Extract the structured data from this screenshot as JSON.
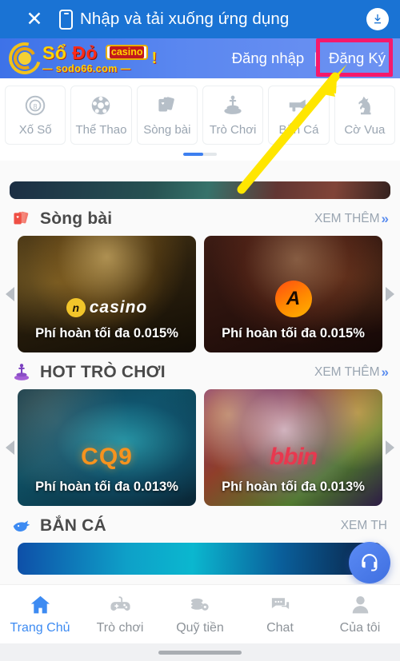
{
  "topbar": {
    "close_icon": "close-x-icon",
    "phone_icon": "mobile-phone-icon",
    "title": "Nhập và tải xuống ứng dụng",
    "download_icon": "download-arrow-icon"
  },
  "site_header": {
    "logo": {
      "main_left": "Sổ ",
      "main_right": "Đỏ",
      "badge": "casino",
      "sub": "— sodo66.com —",
      "exclaim": "!"
    },
    "login_label": "Đăng nhập",
    "divider": "|",
    "register_label": "Đăng Ký",
    "highlight_color": "#f5196b"
  },
  "categories": [
    {
      "label": "Xố Số",
      "icon": "lottery-ball-icon"
    },
    {
      "label": "Thể Thao",
      "icon": "soccer-ball-icon"
    },
    {
      "label": "Sòng bài",
      "icon": "playing-cards-icon"
    },
    {
      "label": "Trò Chơi",
      "icon": "joystick-icon"
    },
    {
      "label": "Bắn Cá",
      "icon": "fish-gun-icon"
    },
    {
      "label": "Cờ Vua",
      "icon": "chess-knight-icon"
    }
  ],
  "pager": {
    "active_index": 0,
    "count": 2
  },
  "sections": [
    {
      "id": "song-bai",
      "title": "Sòng bài",
      "icon": "playing-cards-icon",
      "more_label": "XEM THÊM",
      "more_chevron": "»",
      "cards": [
        {
          "brand": "casino",
          "brand_mark": "n",
          "fee": "Phí hoàn tối đa 0.015%",
          "art": "art-a"
        },
        {
          "brand": "AE",
          "brand_mark": "A",
          "fee": "Phí hoàn tối đa 0.015%",
          "art": "art-b"
        }
      ]
    },
    {
      "id": "hot-tro-choi",
      "title": "HOT TRÒ CHƠI",
      "icon": "joystick-icon",
      "more_label": "XEM THÊM",
      "more_chevron": "»",
      "cards": [
        {
          "brand": "CQ9",
          "fee": "Phí hoàn tối đa 0.013%",
          "art": "art-c"
        },
        {
          "brand": "bbin",
          "fee": "Phí hoàn tối đa 0.013%",
          "art": "art-d"
        }
      ]
    },
    {
      "id": "ban-ca",
      "title": "BẮN CÁ",
      "icon": "fish-icon",
      "more_label": "XEM TH",
      "more_chevron": "",
      "cards": []
    }
  ],
  "carousel_arrows": {
    "left": "prev-arrow-icon",
    "right": "next-arrow-icon"
  },
  "fab": {
    "icon": "headset-support-icon"
  },
  "bottom_nav": [
    {
      "label": "Trang Chủ",
      "icon": "home-icon",
      "active": true
    },
    {
      "label": "Trò chơi",
      "icon": "gamepad-icon",
      "active": false
    },
    {
      "label": "Quỹ tiền",
      "icon": "coins-gear-icon",
      "active": false
    },
    {
      "label": "Chat",
      "icon": "chat-bubble-icon",
      "active": false
    },
    {
      "label": "Của tôi",
      "icon": "user-icon",
      "active": false
    }
  ],
  "annotation": {
    "arrow_color": "#ffe600",
    "target": "register-button"
  }
}
